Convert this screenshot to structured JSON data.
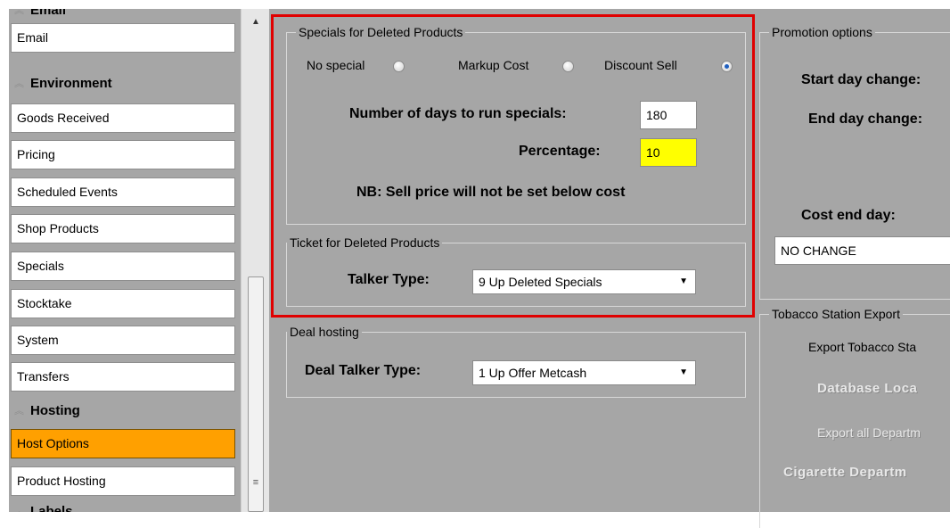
{
  "sidebar": {
    "groups": {
      "email": "Email",
      "environment": "Environment",
      "hosting": "Hosting",
      "labels": "Labels"
    },
    "items": {
      "email": "Email",
      "goods_received": "Goods Received",
      "pricing": "Pricing",
      "scheduled_events": "Scheduled Events",
      "shop_products": "Shop Products",
      "specials": "Specials",
      "stocktake": "Stocktake",
      "system": "System",
      "transfers": "Transfers",
      "host_options": "Host Options",
      "product_hosting": "Product Hosting"
    },
    "active_item": "Host Options"
  },
  "specials_deleted": {
    "title": "Specials for Deleted Products",
    "radios": {
      "no_special": "No special",
      "markup_cost": "Markup Cost",
      "discount_sell": "Discount Sell"
    },
    "selected": "Discount Sell",
    "days_label": "Number of days to run specials:",
    "days_value": "180",
    "percentage_label": "Percentage:",
    "percentage_value": "10",
    "note": "NB: Sell price will not be set below cost"
  },
  "ticket_deleted": {
    "title": "Ticket for Deleted Products",
    "talker_label": "Talker Type:",
    "talker_value": "9 Up Deleted Specials"
  },
  "deal_hosting": {
    "title": "Deal hosting",
    "talker_label": "Deal Talker Type:",
    "talker_value": "1 Up Offer Metcash"
  },
  "promotion_options": {
    "title": "Promotion options",
    "start_day_change": "Start day change:",
    "end_day_change": "End day change:",
    "cost_end_day": "Cost end day:",
    "cost_end_value": "NO CHANGE"
  },
  "tobacco": {
    "title": "Tobacco Station Export",
    "export_label": "Export Tobacco Sta",
    "database_location": "Database Loca",
    "export_all": "Export all Departm",
    "cigarette_dept": "Cigarette Departm"
  },
  "colors": {
    "active_item": "#ffa000",
    "highlight": "#e00000",
    "percentage_field": "#ffff00"
  }
}
